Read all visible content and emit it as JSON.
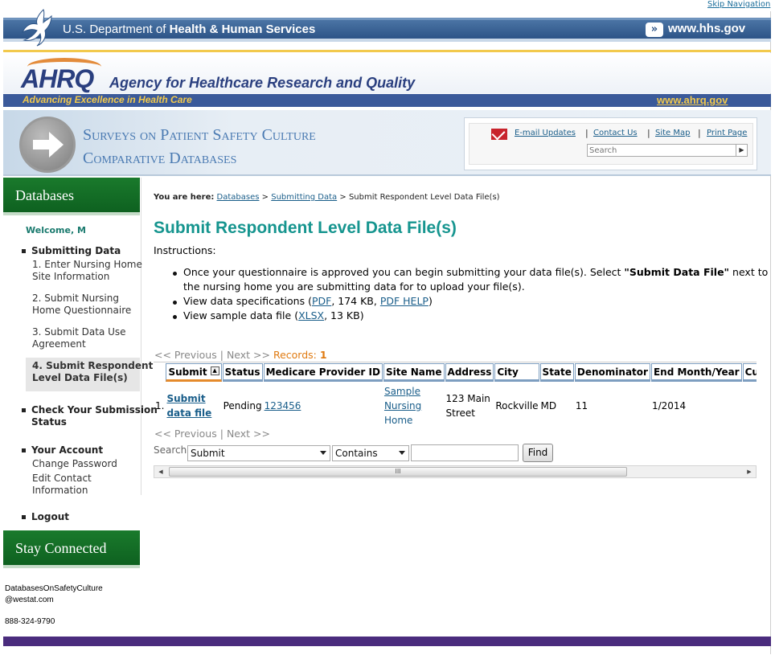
{
  "skip_nav": "Skip Navigation",
  "hhs": {
    "title_prefix": "U.S. Department of ",
    "title_bold": "Health & Human Services",
    "link": "www.hhs.gov"
  },
  "ahrq": {
    "logo": "AHRQ",
    "name": "Agency for Healthcare Research and Quality",
    "tagline": "Advancing Excellence in Health Care",
    "url": "www.ahrq.gov"
  },
  "banner": {
    "line1": "Surveys on Patient Safety Culture",
    "line2": "Comparative Databases"
  },
  "utility": {
    "email_updates": "E-mail Updates",
    "contact_us": "Contact Us",
    "site_map": "Site Map",
    "print_page": "Print Page",
    "search_placeholder": "Search"
  },
  "nav": {
    "databases_heading": "Databases",
    "welcome": "Welcome, M",
    "submitting_data": "Submitting Data",
    "item1_line1": "1. Enter Nursing Home",
    "item1_line2": "Site Information",
    "item2_line1": "2. Submit Nursing",
    "item2_line2": "Home Questionnaire",
    "item3_line1": "3. Submit Data Use",
    "item3_line2": "Agreement",
    "item4_line1": "4. Submit Respondent",
    "item4_line2": "Level Data File(s)",
    "check_line1": "Check Your Submission",
    "check_line2": "Status",
    "your_account": "Your Account",
    "change_password": "Change Password",
    "edit_line1": "Edit Contact",
    "edit_line2": "Information",
    "logout": "Logout",
    "stay_connected": "Stay Connected",
    "contact_email_line1": "DatabasesOnSafetyCulture",
    "contact_email_line2": "@westat.com",
    "contact_phone": "888-324-9790"
  },
  "breadcrumb": {
    "label": "You are here:",
    "crumb1": "Databases",
    "sep": ">",
    "crumb2": "Submitting Data",
    "current": "Submit Respondent Level Data File(s)"
  },
  "main": {
    "title": "Submit Respondent Level Data File(s)",
    "instructions_label": "Instructions:",
    "bullet1_a": "Once your questionnaire is approved you can begin submitting your data file(s). Select ",
    "bullet1_b": "\"Submit Data File\"",
    "bullet1_c": " next to",
    "bullet1_line2": "the nursing home you are submitting data for to upload your file(s).",
    "bullet2_a": "View data specifications (",
    "bullet2_pdf": "PDF",
    "bullet2_b": ", 174 KB, ",
    "bullet2_help": "PDF HELP",
    "bullet2_c": ")",
    "bullet3_a": "View sample data file (",
    "bullet3_xlsx": "XLSX",
    "bullet3_b": ", 13 KB)"
  },
  "pager": {
    "previous": "<< Previous",
    "sep": "|",
    "next": "Next >>",
    "records_label": "Records:",
    "records_count": "1"
  },
  "grid": {
    "columns": [
      "Submit",
      "Status",
      "Medicare Provider ID",
      "Site Name",
      "Address",
      "City",
      "State",
      "Denominator",
      "End Month/Year",
      "Current Data File"
    ],
    "row": {
      "index": "1.",
      "submit": "Submit data file",
      "status": "Pending",
      "provider_id": "123456",
      "site_name_l1": "Sample",
      "site_name_l2": "Nursing",
      "site_name_l3": "Home",
      "address_l1": "123 Main",
      "address_l2": "Street",
      "city": "Rockville",
      "state": "MD",
      "denominator": "11",
      "end_month_year": "1/2014",
      "current_file": ""
    }
  },
  "search": {
    "label": "Search:",
    "field_value": "Submit",
    "operator_value": "Contains",
    "find": "Find"
  },
  "scroll": {
    "grip": "III"
  }
}
